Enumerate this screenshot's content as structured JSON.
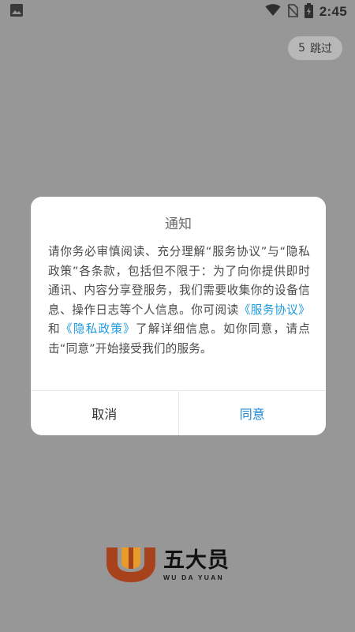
{
  "status_bar": {
    "time": "2:45",
    "icons": [
      "image-icon",
      "wifi-icon",
      "no-sim-icon",
      "battery-charging-icon"
    ]
  },
  "skip": {
    "countdown": "5",
    "label": "跳过"
  },
  "dialog": {
    "title": "通知",
    "body_parts": {
      "p1": "请你务必审慎阅读、充分理解“服务协议”与“隐私政策”各条款，包括但不限于：为了向你提供即时通讯、内容分享登服务，我们需要收集你的设备信息、操作日志等个人信息。你可阅读",
      "link1": "《服务协议》",
      "p2": "和",
      "link2": "《隐私政策》",
      "p3": "了解详细信息。如你同意，请点击“同意”开始接受我们的服务。"
    },
    "cancel_label": "取消",
    "agree_label": "同意"
  },
  "brand": {
    "name": "五大员",
    "subtitle": "WU DA YUAN",
    "colors": {
      "outer": "#a8421c",
      "inner": "#e89a2a",
      "link": "#1e9ae0"
    }
  }
}
